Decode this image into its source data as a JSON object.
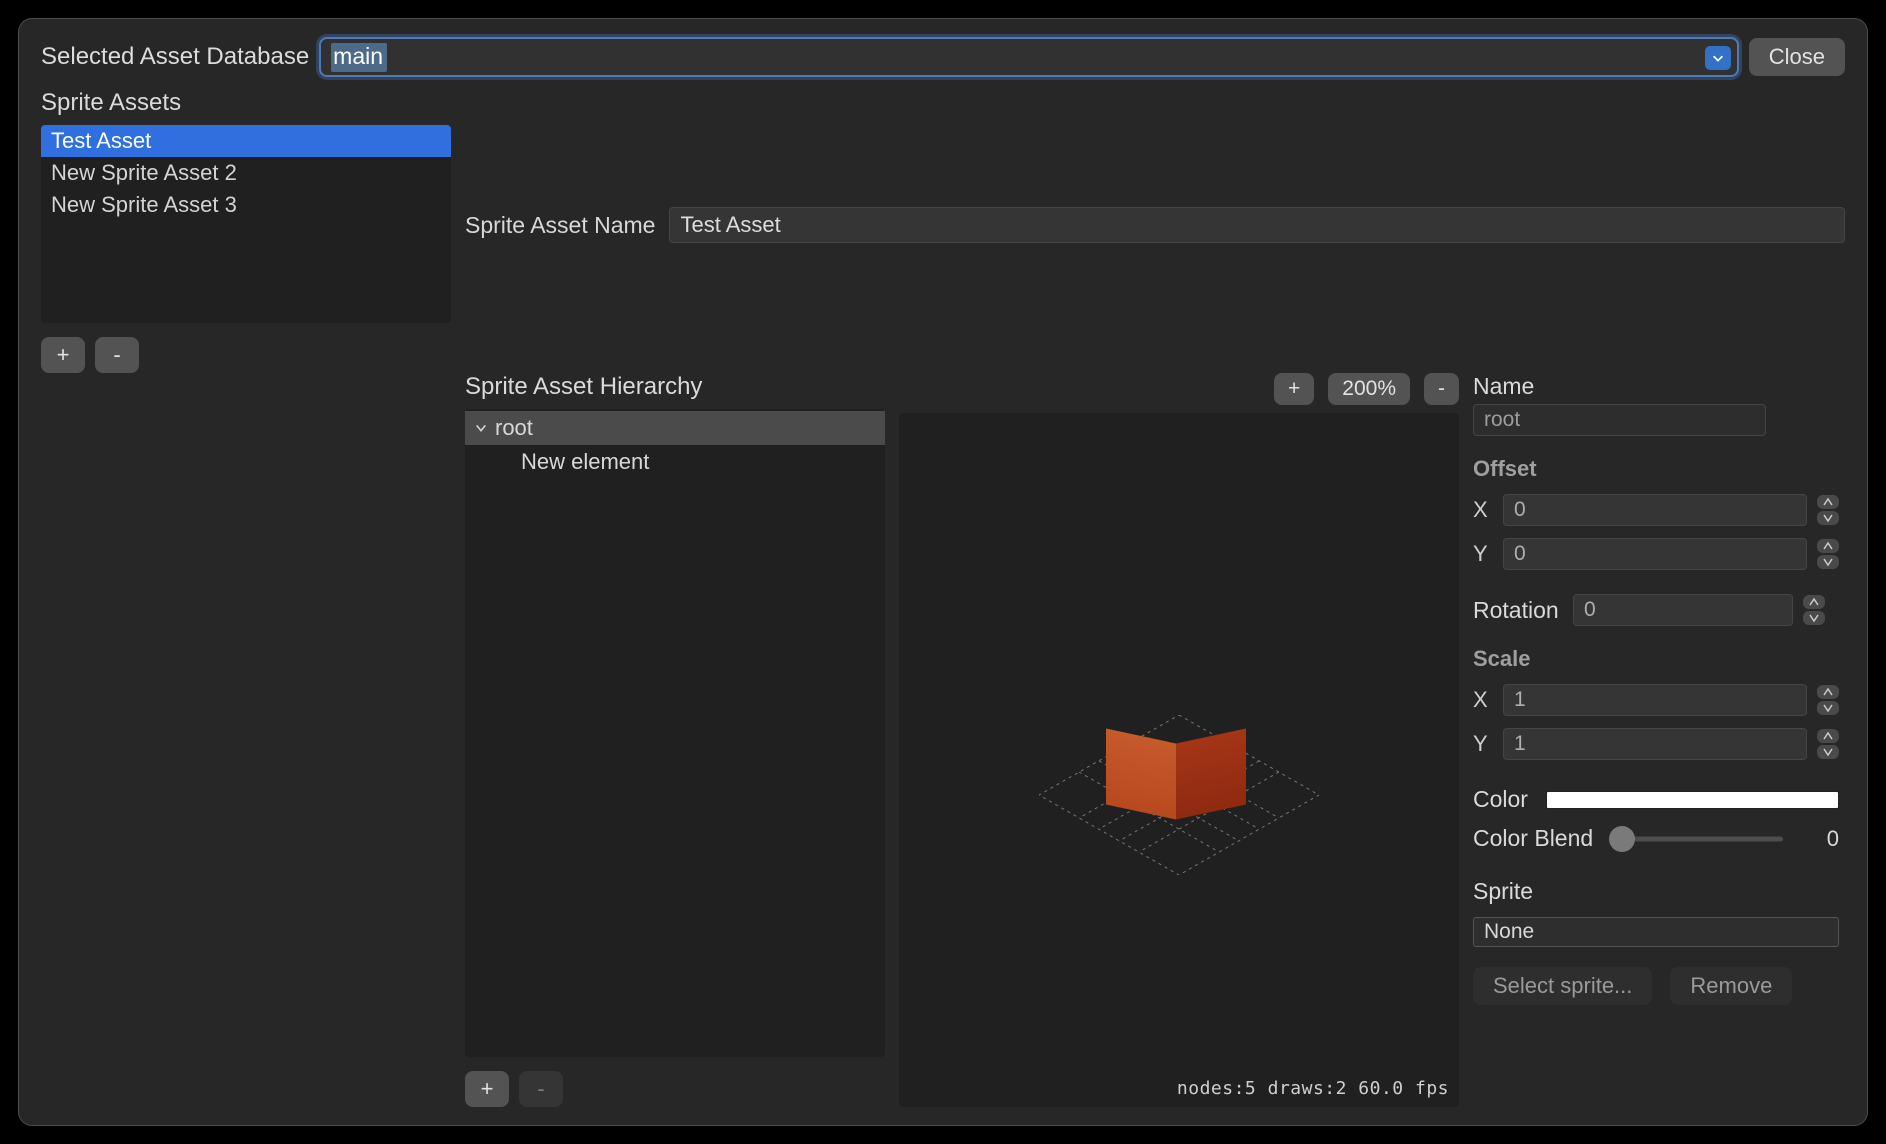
{
  "topbar": {
    "label": "Selected Asset Database",
    "selected_db": "main",
    "close_label": "Close"
  },
  "assets": {
    "title": "Sprite Assets",
    "items": [
      "Test Asset",
      "New Sprite Asset 2",
      "New Sprite Asset 3"
    ],
    "selected_index": 0,
    "add_label": "+",
    "remove_label": "-"
  },
  "asset_name": {
    "label": "Sprite Asset Name",
    "value": "Test Asset"
  },
  "hierarchy": {
    "title": "Sprite Asset Hierarchy",
    "root_label": "root",
    "child_label": "New element",
    "add_label": "+",
    "remove_label": "-"
  },
  "preview": {
    "zoom_in_label": "+",
    "zoom_label": "200%",
    "zoom_out_label": "-",
    "stats": "nodes:5 draws:2  60.0 fps"
  },
  "props": {
    "name_label": "Name",
    "name_value": "root",
    "offset_label": "Offset",
    "offset_x": "0",
    "offset_y": "0",
    "rotation_label": "Rotation",
    "rotation_value": "0",
    "scale_label": "Scale",
    "scale_x": "1",
    "scale_y": "1",
    "axis_x": "X",
    "axis_y": "Y",
    "color_label": "Color",
    "color_value": "#FFFFFF",
    "blend_label": "Color Blend",
    "blend_value": "0",
    "sprite_section": "Sprite",
    "sprite_value": "None",
    "select_sprite_label": "Select sprite...",
    "remove_label": "Remove"
  }
}
